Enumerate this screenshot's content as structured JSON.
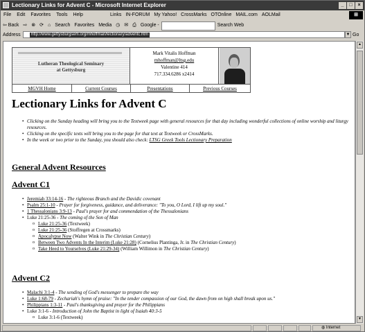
{
  "window": {
    "title": "Lectionary Links for Advent C - Microsoft Internet Explorer",
    "buttons": [
      "_",
      "□",
      "×"
    ]
  },
  "menu": {
    "items": [
      "File",
      "Edit",
      "Favorites",
      "Tools",
      "Help"
    ],
    "links_label": "Links",
    "links": [
      "IN-FORUM",
      "My Yahoo!",
      "CrossMarks",
      "OTOnline",
      "MAIL.com",
      "AOLMail"
    ]
  },
  "toolbar": {
    "back": "⇦ Back",
    "forward": "⇨",
    "search": "Search",
    "favorites": "Favorites",
    "media": "Media",
    "google": "Google -",
    "search_web": "Search Web"
  },
  "address": {
    "label": "Address",
    "url": "http://www.gettysburgsem.org/mhoffman/lectionary/adventc.htm",
    "go": "Go"
  },
  "header": {
    "logo_line1": "Lutheran Theological Seminary",
    "logo_line2": "at Gettysburg",
    "name": "Mark Vitalis Hoffman",
    "email": "mhoffman@ltsg.edu",
    "office": "Valentine 414",
    "phone": "717.334.6286 x2414",
    "nav": [
      "MGVH Home",
      "Current Courses",
      "Presentations",
      "Previous Courses"
    ]
  },
  "page_title": "Lectionary Links for Advent C",
  "intro": [
    "Clicking on the Sunday heading will bring you to the Textweek page with general resources for that day including wonderful collections of online worship and liturgy resources.",
    "Clicking on the specific texts will bring you to the page for that text at Textweek or CrossMarks.",
    "In the week or two prior to the Sunday, you should also check: "
  ],
  "intro_link": "LTSG Greek Tools Lectionary Preparation",
  "general_heading": "General Advent Resources",
  "c1": {
    "heading": "Advent C1",
    "items": [
      {
        "ref": "Jeremiah 33:14-16",
        "desc": " - The righteous Branch and the Davidic covenant"
      },
      {
        "ref": "Psalm 25:1-10",
        "desc": " - Prayer for forgiveness, guidance, and deliverance: \"To you, O Lord, I lift up my soul.\""
      },
      {
        "ref": "1 Thessalonians 3:9-13",
        "desc": " - Paul's prayer for and commendation of the Thessalonians"
      },
      {
        "ref": "Luke 21:25-36",
        "desc": " - The coming of the Son of Man"
      }
    ],
    "sub": [
      {
        "link": "Luke 21:25-36",
        "rest": " (Textweek)",
        "italic": ""
      },
      {
        "link": "Luke 21:25-36",
        "rest": " (Stoffregen at Crossmarks)",
        "italic": ""
      },
      {
        "link": "Apocalypse Now",
        "rest": " (Walter Wink in ",
        "italic": "The Christian Century",
        "end": ")"
      },
      {
        "link": "Between Two Advents In the Interim (Luke 21:28)",
        "rest": " (Cornelius Plantinga, Jr. in ",
        "italic": "The Christian Century",
        "end": ")"
      },
      {
        "link": "Take Heed to Yourselves (Luke 21:29-34)",
        "rest": " (William Willimon in ",
        "italic": "The Christian Century",
        "end": ")"
      }
    ]
  },
  "c2": {
    "heading": "Advent C2",
    "items": [
      {
        "ref": "Malachi 3:1-4",
        "desc": " - The sending of God's messenger to prepare the way"
      },
      {
        "ref": "Luke 1:68-79",
        "desc": " - Zechariah's hymn of praise: \"In the tender compassion of our God, the dawn from on high shall break upon us.\""
      },
      {
        "ref": "Philippians 1:3-11",
        "desc": " - Paul's thanksgiving and prayer for the Philippians"
      },
      {
        "ref": "Luke 3:1-6",
        "desc": " - Introduction of John the Baptist in light of Isaiah 40:3-5"
      }
    ],
    "sub": [
      {
        "link": "Luke 3:1-6",
        "rest": " (Textweek)"
      }
    ]
  },
  "status": {
    "zone": "Internet"
  }
}
